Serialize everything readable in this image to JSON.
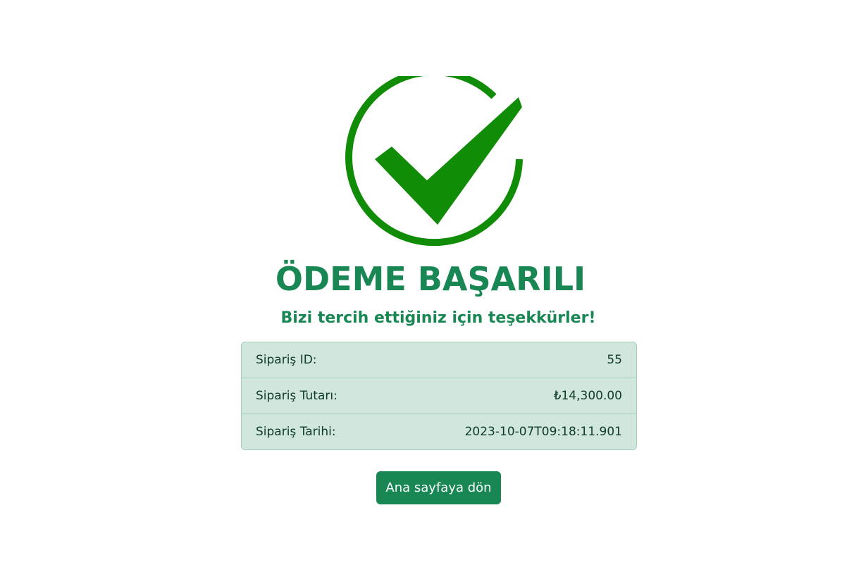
{
  "colors": {
    "success_green": "#198754",
    "check_icon_green": "#118c07",
    "table_background": "#d1e7dd",
    "table_border": "#a3cfbb"
  },
  "icon": "check-circle-icon",
  "heading": {
    "title": "ÖDEME BAŞARILI",
    "subtitle": "Bizi tercih ettiğiniz için teşekkürler!"
  },
  "order": {
    "rows": [
      {
        "label": "Sipariş ID:",
        "value": "55"
      },
      {
        "label": "Sipariş Tutarı:",
        "value": "₺14,300.00"
      },
      {
        "label": "Sipariş Tarihi:",
        "value": "2023-10-07T09:18:11.901"
      }
    ]
  },
  "actions": {
    "home_label": "Ana sayfaya dön"
  }
}
